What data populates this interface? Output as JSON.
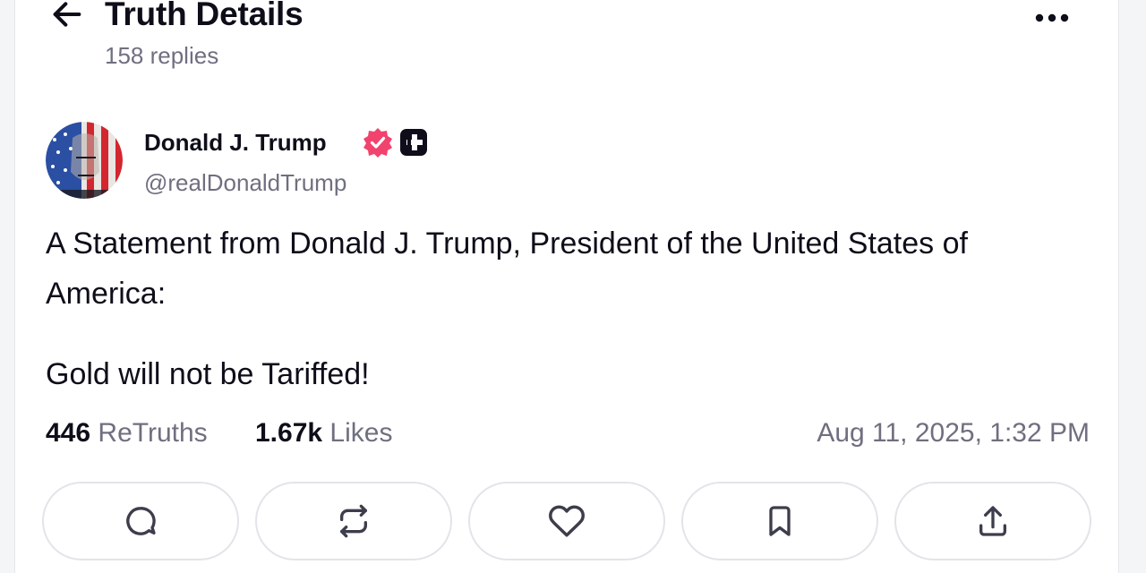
{
  "header": {
    "title": "Truth Details",
    "reply_count": "158 replies",
    "back_icon": "arrow-left-icon",
    "more_icon": "more-horizontal-icon"
  },
  "post": {
    "author": {
      "display_name": "Donald J. Trump",
      "handle": "@realDonaldTrump",
      "verified_color": "#f2426e"
    },
    "paragraphs": [
      "A Statement from Donald J. Trump, President of the United States of America:",
      "Gold will not be Tariffed!"
    ],
    "stats": {
      "retruths_count": "446",
      "retruths_label": "ReTruths",
      "likes_count": "1.67k",
      "likes_label": "Likes",
      "timestamp": "Aug 11, 2025, 1:32 PM"
    },
    "actions": [
      {
        "icon": "reply-icon"
      },
      {
        "icon": "retruth-icon"
      },
      {
        "icon": "like-icon"
      },
      {
        "icon": "bookmark-icon"
      },
      {
        "icon": "share-icon"
      }
    ]
  },
  "colors": {
    "text": "#0e0e1a",
    "muted": "#6f6f80",
    "border": "#e3e4ea",
    "verified": "#f2426e"
  }
}
